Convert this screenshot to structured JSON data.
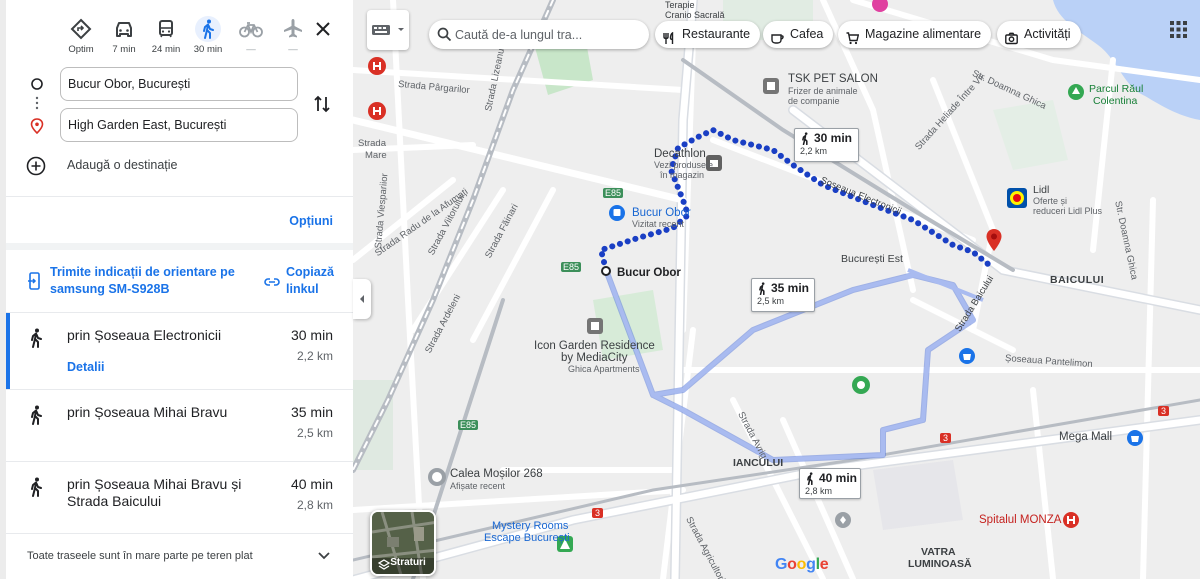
{
  "modes": [
    {
      "label": "Optim",
      "icon": "best-route-icon",
      "state": "normal"
    },
    {
      "label": "7 min",
      "icon": "car-icon",
      "state": "normal"
    },
    {
      "label": "24 min",
      "icon": "transit-icon",
      "state": "normal"
    },
    {
      "label": "30 min",
      "icon": "walking-icon",
      "state": "active"
    },
    {
      "label": "—",
      "icon": "bicycle-icon",
      "state": "disabled"
    },
    {
      "label": "—",
      "icon": "flight-icon",
      "state": "disabled"
    }
  ],
  "origin": "Bucur Obor, București",
  "destination": "High Garden East, București",
  "add_destination": "Adaugă o destinație",
  "options_link": "Opțiuni",
  "send_to_device": "Trimite indicații de orientare pe samsung SM-S928B",
  "copy_link": "Copiază linkul",
  "routes": [
    {
      "name": "prin Șoseaua Electronicii",
      "time": "30 min",
      "distance": "2,2 km",
      "details": "Detalii",
      "selected": true
    },
    {
      "name": "prin Șoseaua Mihai Bravu",
      "time": "35 min",
      "distance": "2,5 km",
      "details": "",
      "selected": false
    },
    {
      "name": "prin Șoseaua Mihai Bravu și Strada Baicului",
      "time": "40 min",
      "distance": "2,8 km",
      "details": "",
      "selected": false
    }
  ],
  "terrain_note": "Toate traseele sunt în mare parte pe teren plat",
  "search": {
    "placeholder": "Caută de-a lungul tra..."
  },
  "chips": [
    {
      "label": "Restaurante",
      "icon": "fork-knife-icon"
    },
    {
      "label": "Cafea",
      "icon": "coffee-icon"
    },
    {
      "label": "Magazine alimentare",
      "icon": "cart-icon"
    },
    {
      "label": "Activități",
      "icon": "camera-icon"
    }
  ],
  "layers_label": "Straturi",
  "route_badges": [
    {
      "time": "30 min",
      "distance": "2,2 km"
    },
    {
      "time": "35 min",
      "distance": "2,5 km"
    },
    {
      "time": "40 min",
      "distance": "2,8 km"
    }
  ],
  "map_labels": {
    "bucur_obor_pin": "Bucur Obor",
    "bucur_obor_transit": "Bucur Obor",
    "bucur_obor_transit_sub": "Vizitat recent",
    "decathlon": "Decathlon",
    "decathlon_sub1": "Vezi produsele",
    "decathlon_sub2": "în magazin",
    "tsk": "TSK PET SALON",
    "tsk_sub1": "Frizer de animale",
    "tsk_sub2": "de companie",
    "lidl": "Lidl",
    "lidl_sub1": "Oferte și",
    "lidl_sub2": "reduceri Lidl Plus",
    "lidl2": "Lidl",
    "parcul": "Parcul Răul",
    "parcul2": "Colentina",
    "bucuresti_est": "București Est",
    "baicului": "BAICULUI",
    "icon_garden": "Icon Garden Residence",
    "icon_garden2": "by MediaCity",
    "ghica": "Ghica Apartments",
    "calea_mosilor": "Calea Moșilor 268",
    "afisate": "Afișate recent",
    "mega_mall": "Mega Mall",
    "iancului": "IANCULUI",
    "mystery1": "Mystery Rooms",
    "mystery2": "Escape București",
    "spitalul": "Spitalul MONZA",
    "vatra1": "VATRA",
    "vatra2": "LUMINOASĂ",
    "sos_pantelimon": "Șoseaua Pantelimon",
    "strada_pargarilor": "Strada Pârgarilor",
    "strada_mare": "Strada",
    "strada_mare2": "Mare",
    "strada_lizeanu": "Strada Lizeanu",
    "strada_doamna_ghica": "Str. Doamna Ghica",
    "strada_heliade": "Strada Heliade Între Vii",
    "sos_electronicii": "Șoseaua Electronicii",
    "strada_baicului": "Strada Baicului",
    "strada_vesparilor": "Strada Viespariior",
    "strada_radu": "Strada Radu de la Afumați",
    "strada_viitorului": "Strada Viitorului",
    "strada_fainari": "Strada Făinari",
    "strada_ardeleni": "Strada Ardeleni",
    "strada_avrig": "Strada Avrig",
    "strada_agricultori": "Strada Agricultori",
    "strada_doamna_ghica2": "Str. Doamna Ghica",
    "cranio_sacrala": "Cranio Sacrală",
    "terapie": "Terapie",
    "e85a": "E85",
    "e85b": "E85",
    "e85c": "E85",
    "r3a": "3",
    "r3b": "3",
    "r3c": "3",
    "google": "Google"
  },
  "colors": {
    "selected_route": "#1a3fc4",
    "alt_route": "#8ea7ea",
    "accent": "#1a73e8",
    "destination_pin": "#d93025"
  }
}
